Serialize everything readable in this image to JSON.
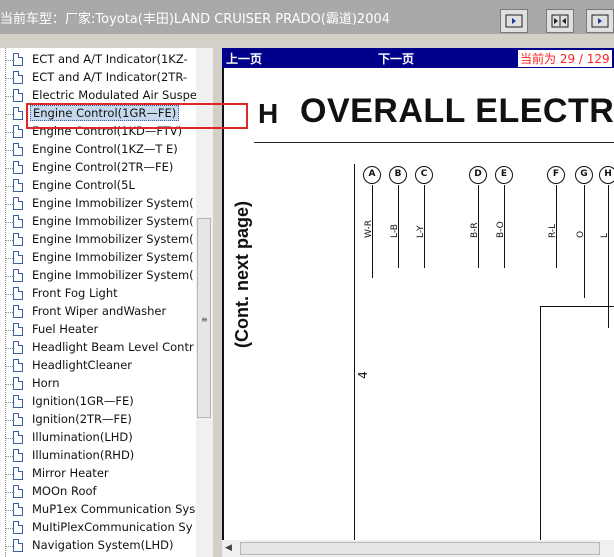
{
  "header": {
    "title": "当前车型：厂家:Toyota(丰田)LAND CRUISER PRADO(霸道)2004"
  },
  "tree": {
    "items": [
      {
        "label": "ECT and A/T Indicator(1KZ-"
      },
      {
        "label": "ECT and A/T Indicator(2TR-"
      },
      {
        "label": "Electric Modulated Air Suspe"
      },
      {
        "label": "Engine Control(1GR—FE)",
        "selected": true
      },
      {
        "label": "Engine Control(1KD—FTV)"
      },
      {
        "label": "Engine Control(1KZ—T E)"
      },
      {
        "label": "Engine Control(2TR—FE)"
      },
      {
        "label": "Engine Control(5L"
      },
      {
        "label": "Engine Immobilizer System("
      },
      {
        "label": "Engine Immobilizer System("
      },
      {
        "label": "Engine Immobilizer System("
      },
      {
        "label": "Engine Immobilizer System("
      },
      {
        "label": "Engine Immobilizer System("
      },
      {
        "label": "Front Fog Light"
      },
      {
        "label": "Front Wiper andWasher"
      },
      {
        "label": "Fuel Heater"
      },
      {
        "label": "Headlight Beam Level Contr"
      },
      {
        "label": "HeadlightCleaner"
      },
      {
        "label": "Horn"
      },
      {
        "label": "Ignition(1GR—FE)"
      },
      {
        "label": "Ignition(2TR—FE)"
      },
      {
        "label": "Illumination(LHD)"
      },
      {
        "label": "Illumination(RHD)"
      },
      {
        "label": "Mirror Heater"
      },
      {
        "label": "MOOn Roof"
      },
      {
        "label": "MuP1ex Communication Sys"
      },
      {
        "label": "MuItiPlexCommunication Sy"
      },
      {
        "label": "Navigation System(LHD)"
      }
    ]
  },
  "navbar": {
    "prev_label": "上一页",
    "next_label": "下一页",
    "page_indicator": "当前为 29 / 129"
  },
  "document": {
    "section_letter": "H",
    "heading": "OVERALL ELECTRIC",
    "continued_note": "(Cont.  next page)",
    "number_label": "4",
    "connectors": [
      "A",
      "B",
      "C",
      "D",
      "E",
      "F",
      "G",
      "H"
    ],
    "wire_labels": [
      "W-R",
      "L-B",
      "L-Y",
      "B-R",
      "B-O",
      "R-L",
      "O",
      "L"
    ]
  }
}
